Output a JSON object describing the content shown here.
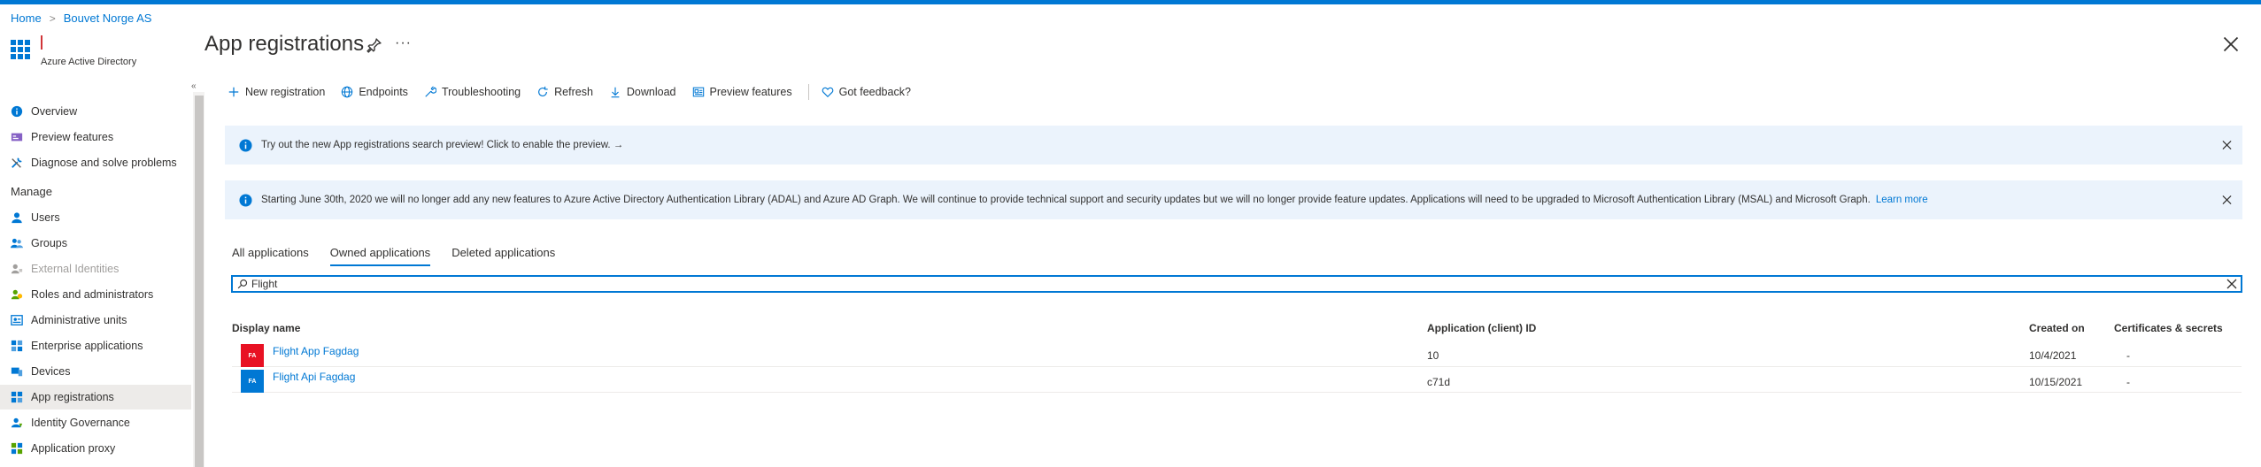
{
  "breadcrumb": {
    "home": "Home",
    "tenant": "Bouvet Norge AS"
  },
  "service": {
    "name": "Azure Active Directory"
  },
  "page": {
    "title": "App registrations",
    "more": "···"
  },
  "sidebar": {
    "items_top": [
      {
        "label": "Overview"
      },
      {
        "label": "Preview features"
      },
      {
        "label": "Diagnose and solve problems"
      }
    ],
    "manage_heading": "Manage",
    "items_manage": [
      {
        "label": "Users"
      },
      {
        "label": "Groups"
      },
      {
        "label": "External Identities"
      },
      {
        "label": "Roles and administrators"
      },
      {
        "label": "Administrative units"
      },
      {
        "label": "Enterprise applications"
      },
      {
        "label": "Devices"
      },
      {
        "label": "App registrations"
      },
      {
        "label": "Identity Governance"
      },
      {
        "label": "Application proxy"
      }
    ],
    "collapse": "«"
  },
  "toolbar": {
    "new_registration": "New registration",
    "endpoints": "Endpoints",
    "troubleshooting": "Troubleshooting",
    "refresh": "Refresh",
    "download": "Download",
    "preview_features": "Preview features",
    "feedback": "Got feedback?"
  },
  "banners": {
    "search_preview": "Try out the new App registrations search preview! Click to enable the preview. →",
    "adal_notice": "Starting June 30th, 2020 we will no longer add any new features to Azure Active Directory Authentication Library (ADAL) and Azure AD Graph. We will continue to provide technical support and security updates but we will no longer provide feature updates. Applications will need to be upgraded to Microsoft Authentication Library (MSAL) and Microsoft Graph.",
    "learn_more": "Learn more"
  },
  "tabs": {
    "all": "All applications",
    "owned": "Owned applications",
    "deleted": "Deleted applications"
  },
  "search": {
    "value": "Flight"
  },
  "table": {
    "headers": {
      "display_name": "Display name",
      "app_id": "Application (client) ID",
      "created_on": "Created on",
      "certs": "Certificates & secrets"
    },
    "rows": [
      {
        "initials": "FA",
        "avatar_color": "#e81123",
        "name": "Flight App Fagdag",
        "app_id": "10",
        "created_on": "10/4/2021",
        "certs": "-"
      },
      {
        "initials": "FA",
        "avatar_color": "#0078d4",
        "name": "Flight Api Fagdag",
        "app_id": "c71d",
        "created_on": "10/15/2021",
        "certs": "-"
      }
    ]
  },
  "colors": {
    "accent": "#0078d4",
    "banner": "#ebf3fc",
    "active_nav": "#edebe9"
  }
}
